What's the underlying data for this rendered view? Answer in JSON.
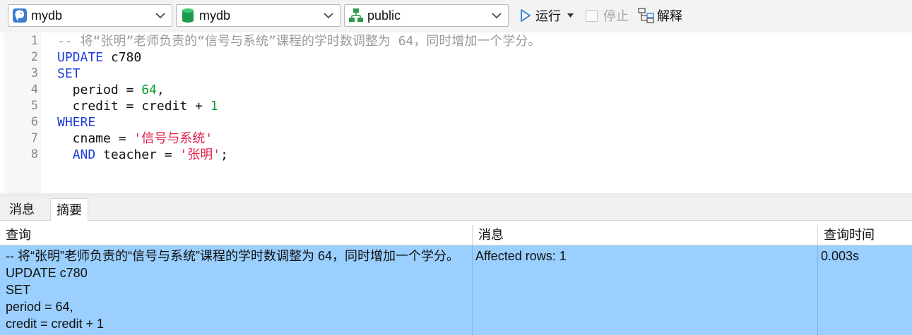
{
  "toolbar": {
    "connection": {
      "label": "mydb",
      "icon": "postgresql-elephant-icon"
    },
    "database": {
      "label": "mydb",
      "icon": "database-cylinder-icon"
    },
    "schema": {
      "label": "public",
      "icon": "schema-tree-icon"
    },
    "run_label": "运行",
    "stop_label": "停止",
    "explain_label": "解释"
  },
  "editor": {
    "line_numbers": [
      "1",
      "2",
      "3",
      "4",
      "5",
      "6",
      "7",
      "8"
    ],
    "lines": [
      [
        {
          "t": "-- 将“张明”老师负责的“信号与系统”课程的学时数调整为 64，同时增加一个学分。",
          "k": "comment"
        }
      ],
      [
        {
          "t": "UPDATE",
          "k": "kw"
        },
        {
          "t": " c780",
          "k": "id"
        }
      ],
      [
        {
          "t": "SET",
          "k": "kw"
        }
      ],
      [
        {
          "t": "  period = ",
          "k": "id"
        },
        {
          "t": "64",
          "k": "num"
        },
        {
          "t": ",",
          "k": "id"
        }
      ],
      [
        {
          "t": "  credit = credit + ",
          "k": "id"
        },
        {
          "t": "1",
          "k": "num"
        }
      ],
      [
        {
          "t": "WHERE",
          "k": "kw"
        }
      ],
      [
        {
          "t": "  cname = ",
          "k": "id"
        },
        {
          "t": "'信号与系统'",
          "k": "str"
        }
      ],
      [
        {
          "t": "  ",
          "k": "id"
        },
        {
          "t": "AND",
          "k": "kw"
        },
        {
          "t": " teacher = ",
          "k": "id"
        },
        {
          "t": "'张明'",
          "k": "str"
        },
        {
          "t": ";",
          "k": "id"
        }
      ]
    ]
  },
  "result_tabs": {
    "messages": "消息",
    "summary": "摘要"
  },
  "results": {
    "columns": {
      "query": "查询",
      "message": "消息",
      "time": "查询时间"
    },
    "row": {
      "query_lines": [
        "-- 将“张明”老师负责的“信号与系统”课程的学时数调整为 64，同时增加一个学分。",
        "UPDATE c780",
        "SET",
        "period = 64,",
        "credit = credit + 1"
      ],
      "message": "Affected rows: 1",
      "time": "0.003s"
    }
  },
  "colors": {
    "keyword": "#1a3bd8",
    "number": "#0a9f2a",
    "string": "#e0204a",
    "comment": "#9a9a9a",
    "selected_row": "#9acfff"
  }
}
